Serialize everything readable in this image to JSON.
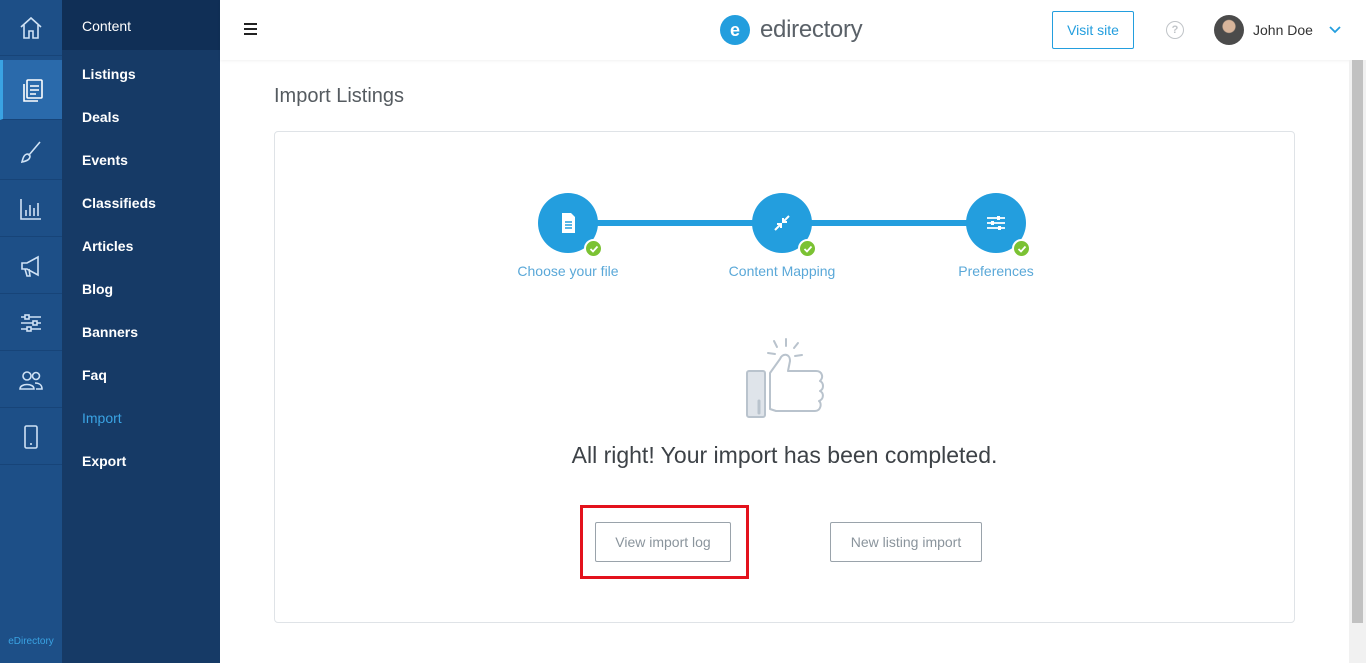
{
  "rail": {
    "items": [
      {
        "icon": "home-icon"
      },
      {
        "icon": "content-icon",
        "active": true
      },
      {
        "icon": "brush-icon"
      },
      {
        "icon": "chart-icon"
      },
      {
        "icon": "megaphone-icon"
      },
      {
        "icon": "sliders-icon"
      },
      {
        "icon": "users-icon"
      },
      {
        "icon": "mobile-icon"
      }
    ],
    "brand": "eDirectory"
  },
  "submenu": {
    "title": "Content",
    "items": [
      {
        "label": "Listings"
      },
      {
        "label": "Deals"
      },
      {
        "label": "Events"
      },
      {
        "label": "Classifieds"
      },
      {
        "label": "Articles"
      },
      {
        "label": "Blog"
      },
      {
        "label": "Banners"
      },
      {
        "label": "Faq"
      },
      {
        "label": "Import",
        "active": true
      },
      {
        "label": "Export"
      }
    ]
  },
  "header": {
    "logo_letter": "e",
    "logo_text": "edirectory",
    "visit_site": "Visit site",
    "help": "?",
    "user_name": "John Doe"
  },
  "main": {
    "title": "Import Listings",
    "steps": [
      {
        "label": "Choose your file",
        "icon": "file-icon",
        "done": true
      },
      {
        "label": "Content Mapping",
        "icon": "compress-icon",
        "done": true
      },
      {
        "label": "Preferences",
        "icon": "sliders-icon",
        "done": true
      }
    ],
    "message": "All right! Your import has been completed.",
    "view_log_label": "View import log",
    "new_import_label": "New listing import"
  },
  "colors": {
    "accent": "#239ede",
    "rail": "#1d4f87",
    "submenu": "#163a66",
    "success": "#7bc233",
    "highlight": "#e3121c"
  }
}
